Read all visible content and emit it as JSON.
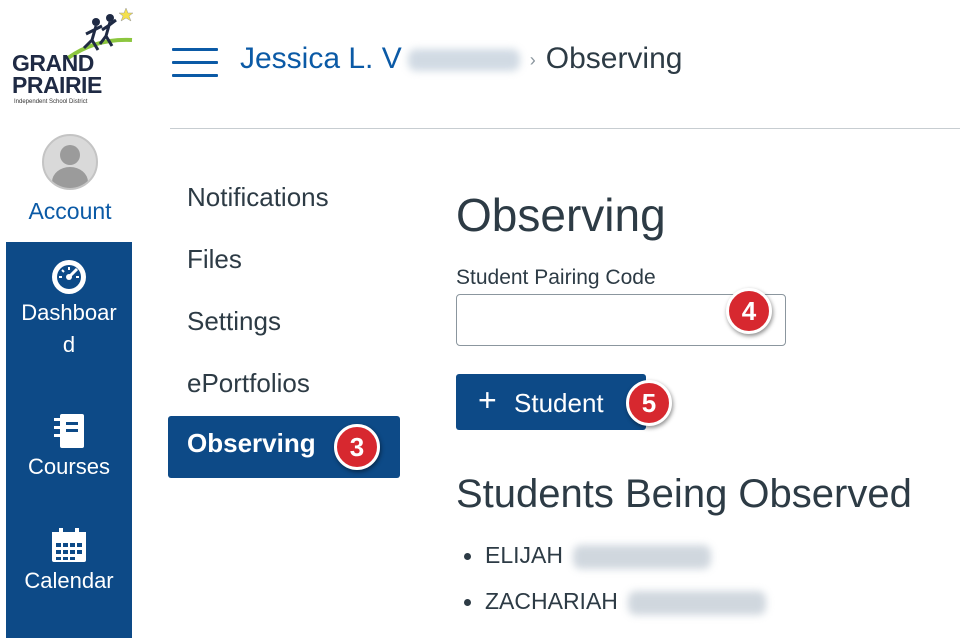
{
  "logo": {
    "line1": "GRAND",
    "line2": "PRAIRIE",
    "line3": "Independent School District"
  },
  "global_nav": {
    "account": "Account",
    "dashboard": [
      "Dashboar",
      "d"
    ],
    "courses": "Courses",
    "calendar": "Calendar"
  },
  "breadcrumb": {
    "user": "Jessica L. V",
    "separator": "›",
    "current": "Observing"
  },
  "sub_nav": [
    "Notifications",
    "Files",
    "Settings",
    "ePortfolios",
    "Observing"
  ],
  "main": {
    "title": "Observing",
    "pairing_label": "Student Pairing Code",
    "pairing_value": "",
    "add_button": "Student",
    "section_title": "Students Being Observed",
    "students": [
      "ELIJAH",
      "ZACHARIAH"
    ]
  },
  "callouts": {
    "observing": "3",
    "code_field": "4",
    "add_button": "5"
  },
  "colors": {
    "nav_blue": "#0d4a87",
    "link_blue": "#0b5aa6",
    "callout_red": "#d7282f"
  }
}
